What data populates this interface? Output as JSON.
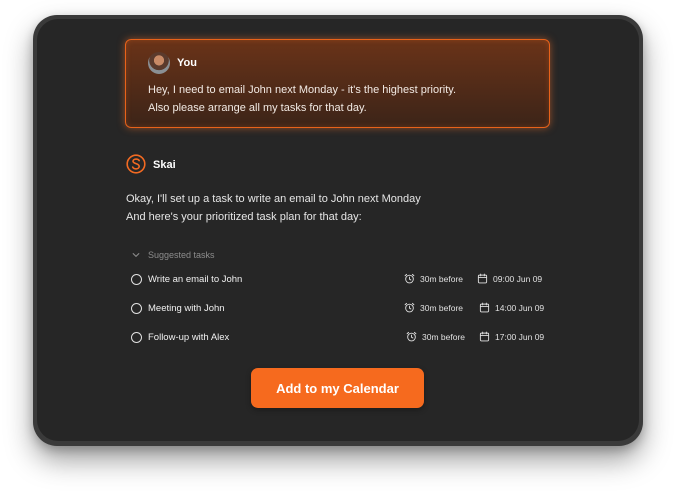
{
  "user_message": {
    "sender": "You",
    "lines": [
      "Hey, I need to email John next Monday - it's the highest priority.",
      "Also please arrange all my tasks for that day."
    ]
  },
  "assistant": {
    "name": "Skai",
    "logo_icon": "skai-logo-icon",
    "lines": [
      "Okay, I'll set up a task to write an email to John next Monday",
      "And here's your prioritized task plan for that day:"
    ]
  },
  "suggested": {
    "label": "Suggested tasks",
    "tasks": [
      {
        "title": "Write an email to John",
        "reminder": "30m before",
        "datetime": "09:00 Jun 09"
      },
      {
        "title": "Meeting with John",
        "reminder": "30m before",
        "datetime": "14:00 Jun 09"
      },
      {
        "title": "Follow-up with Alex",
        "reminder": "30m before",
        "datetime": "17:00 Jun 09"
      }
    ]
  },
  "cta": {
    "label": "Add to my Calendar"
  },
  "colors": {
    "accent": "#f66a1e",
    "screen_bg": "#262626",
    "bezel": "#3a3a3a"
  }
}
